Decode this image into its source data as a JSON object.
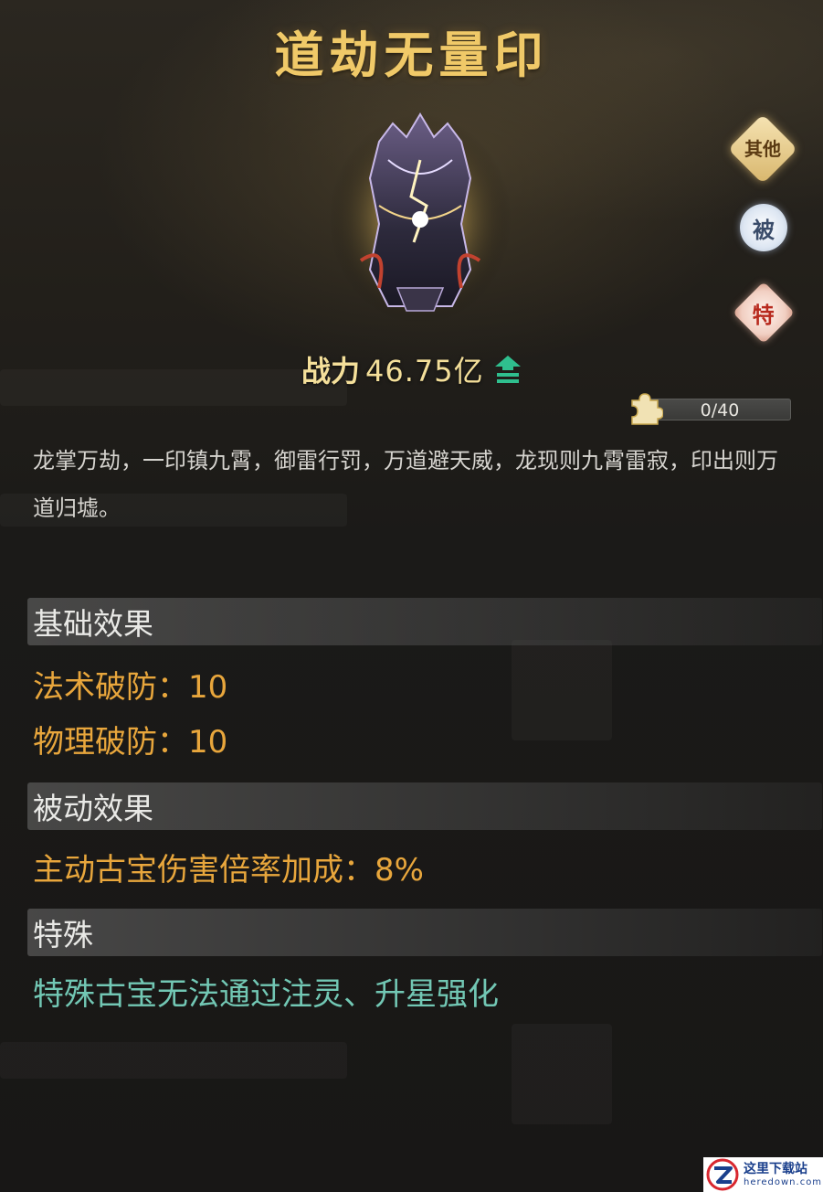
{
  "title": "道劫无量印",
  "side_buttons": {
    "other": "其他",
    "passive": "被",
    "special": "特"
  },
  "power": {
    "label": "战力",
    "value": "46.75亿"
  },
  "fragment": {
    "progress": "0/40",
    "current": 0,
    "total": 40
  },
  "description": "龙掌万劫，一印镇九霄，御雷行罚，万道避天威，龙现则九霄雷寂，印出则万道归墟。",
  "sections": {
    "basic": {
      "title": "基础效果",
      "stats": [
        "法术破防：10",
        "物理破防：10"
      ]
    },
    "passive": {
      "title": "被动效果",
      "stats": [
        "主动古宝伤害倍率加成：8%"
      ]
    },
    "special": {
      "title": "特殊",
      "text": "特殊古宝无法通过注灵、升星强化"
    }
  },
  "watermark": {
    "line1": "这里下载站",
    "line2": "heredown.com"
  },
  "colors": {
    "title": "#f0c968",
    "stat": "#e8a63c",
    "special": "#72c7b4",
    "power": "#f4df9a",
    "up_arrow": "#2fbf8e"
  }
}
